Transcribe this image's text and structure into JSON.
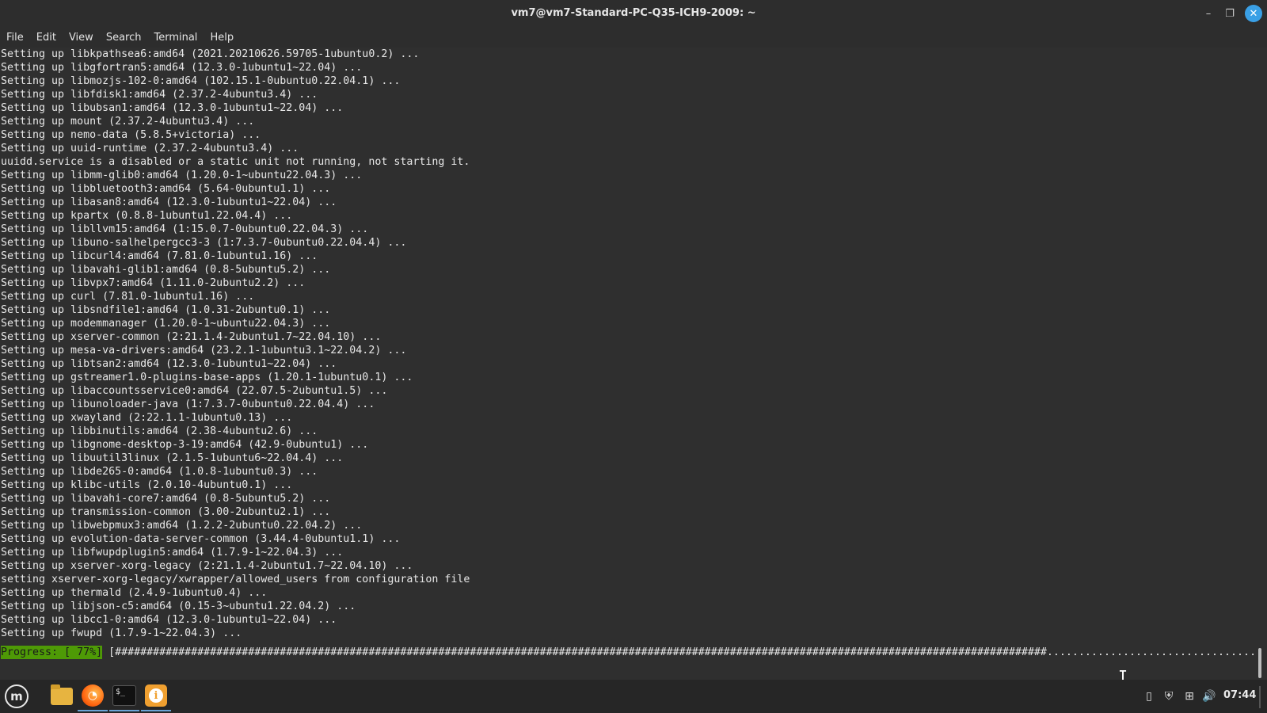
{
  "window": {
    "title": "vm7@vm7-Standard-PC-Q35-ICH9-2009: ~",
    "minimize_glyph": "–",
    "maximize_glyph": "❐",
    "close_glyph": "✕"
  },
  "menubar": {
    "items": [
      "File",
      "Edit",
      "View",
      "Search",
      "Terminal",
      "Help"
    ]
  },
  "terminal": {
    "lines": [
      "Setting up libkpathsea6:amd64 (2021.20210626.59705-1ubuntu0.2) ...",
      "Setting up libgfortran5:amd64 (12.3.0-1ubuntu1~22.04) ...",
      "Setting up libmozjs-102-0:amd64 (102.15.1-0ubuntu0.22.04.1) ...",
      "Setting up libfdisk1:amd64 (2.37.2-4ubuntu3.4) ...",
      "Setting up libubsan1:amd64 (12.3.0-1ubuntu1~22.04) ...",
      "Setting up mount (2.37.2-4ubuntu3.4) ...",
      "Setting up nemo-data (5.8.5+victoria) ...",
      "Setting up uuid-runtime (2.37.2-4ubuntu3.4) ...",
      "uuidd.service is a disabled or a static unit not running, not starting it.",
      "Setting up libmm-glib0:amd64 (1.20.0-1~ubuntu22.04.3) ...",
      "Setting up libbluetooth3:amd64 (5.64-0ubuntu1.1) ...",
      "Setting up libasan8:amd64 (12.3.0-1ubuntu1~22.04) ...",
      "Setting up kpartx (0.8.8-1ubuntu1.22.04.4) ...",
      "Setting up libllvm15:amd64 (1:15.0.7-0ubuntu0.22.04.3) ...",
      "Setting up libuno-salhelpergcc3-3 (1:7.3.7-0ubuntu0.22.04.4) ...",
      "Setting up libcurl4:amd64 (7.81.0-1ubuntu1.16) ...",
      "Setting up libavahi-glib1:amd64 (0.8-5ubuntu5.2) ...",
      "Setting up libvpx7:amd64 (1.11.0-2ubuntu2.2) ...",
      "Setting up curl (7.81.0-1ubuntu1.16) ...",
      "Setting up libsndfile1:amd64 (1.0.31-2ubuntu0.1) ...",
      "Setting up modemmanager (1.20.0-1~ubuntu22.04.3) ...",
      "Setting up xserver-common (2:21.1.4-2ubuntu1.7~22.04.10) ...",
      "Setting up mesa-va-drivers:amd64 (23.2.1-1ubuntu3.1~22.04.2) ...",
      "Setting up libtsan2:amd64 (12.3.0-1ubuntu1~22.04) ...",
      "Setting up gstreamer1.0-plugins-base-apps (1.20.1-1ubuntu0.1) ...",
      "Setting up libaccountsservice0:amd64 (22.07.5-2ubuntu1.5) ...",
      "Setting up libunoloader-java (1:7.3.7-0ubuntu0.22.04.4) ...",
      "Setting up xwayland (2:22.1.1-1ubuntu0.13) ...",
      "Setting up libbinutils:amd64 (2.38-4ubuntu2.6) ...",
      "Setting up libgnome-desktop-3-19:amd64 (42.9-0ubuntu1) ...",
      "Setting up libuutil3linux (2.1.5-1ubuntu6~22.04.4) ...",
      "Setting up libde265-0:amd64 (1.0.8-1ubuntu0.3) ...",
      "Setting up klibc-utils (2.0.10-4ubuntu0.1) ...",
      "Setting up libavahi-core7:amd64 (0.8-5ubuntu5.2) ...",
      "Setting up transmission-common (3.00-2ubuntu2.1) ...",
      "Setting up libwebpmux3:amd64 (1.2.2-2ubuntu0.22.04.2) ...",
      "Setting up evolution-data-server-common (3.44.4-0ubuntu1.1) ...",
      "Setting up libfwupdplugin5:amd64 (1.7.9-1~22.04.3) ...",
      "Setting up xserver-xorg-legacy (2:21.1.4-2ubuntu1.7~22.04.10) ...",
      "setting xserver-xorg-legacy/xwrapper/allowed_users from configuration file",
      "Setting up thermald (2.4.9-1ubuntu0.4) ...",
      "Setting up libjson-c5:amd64 (0.15-3~ubuntu1.22.04.2) ...",
      "Setting up libcc1-0:amd64 (12.3.0-1ubuntu1~22.04) ...",
      "Setting up fwupd (1.7.9-1~22.04.3) ..."
    ],
    "progress": {
      "label": "Progress: [ 77%]",
      "percent": 77,
      "bar": "[###################################################################################################################################################.........................................]"
    },
    "cursor_glyph": "I"
  },
  "taskbar": {
    "menu_logo_glyph": "m",
    "terminal_prompt_glyph": "$_",
    "update_glyph": "i",
    "firefox_glyph": "◔",
    "tray": {
      "clipboard_glyph": "▯",
      "shield_glyph": "⛨",
      "network_glyph": "⊞",
      "volume_glyph": "🔊"
    },
    "clock": "07:44"
  },
  "colors": {
    "terminal_bg": "#2f2f2f",
    "progress_green": "#4e9a06",
    "close_button": "#3aa0e6",
    "taskbar_bg": "#262626"
  }
}
